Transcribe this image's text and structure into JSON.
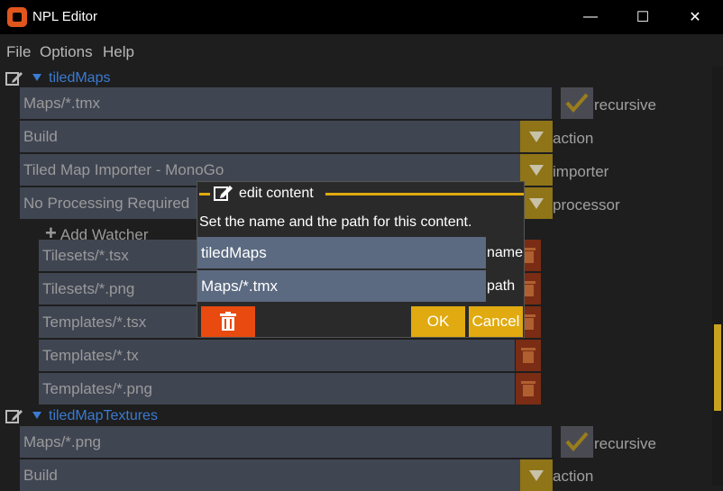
{
  "window": {
    "title": "NPL Editor",
    "minimize": "—",
    "maximize": "☐",
    "close": "✕"
  },
  "menu": {
    "items": [
      "File",
      "Options",
      "Help"
    ]
  },
  "section1": {
    "title": "tiledMaps",
    "path": "Maps/*.tmx",
    "recursive_label": "recursive",
    "action_value": "Build",
    "action_label": "action",
    "importer_value": "Tiled Map Importer - MonoGo",
    "importer_label": "importer",
    "processor_value": "No Processing Required",
    "processor_label": "processor",
    "add_watcher": "Add Watcher",
    "watchers": [
      "Tilesets/*.tsx",
      "Tilesets/*.png",
      "Templates/*.tsx",
      "Templates/*.tx",
      "Templates/*.png"
    ]
  },
  "section2": {
    "title": "tiledMapTextures",
    "path": "Maps/*.png",
    "recursive_label": "recursive",
    "action_value": "Build",
    "action_label": "action"
  },
  "dialog": {
    "title": "edit content",
    "message": "Set the name and the path for this content.",
    "name_value": "tiledMaps",
    "name_label": "name",
    "path_value": "Maps/*.tmx",
    "path_label": "path",
    "ok": "OK",
    "cancel": "Cancel"
  },
  "colors": {
    "accent": "#e0aa10",
    "link": "#3b7bd2",
    "danger": "#e84a10"
  }
}
